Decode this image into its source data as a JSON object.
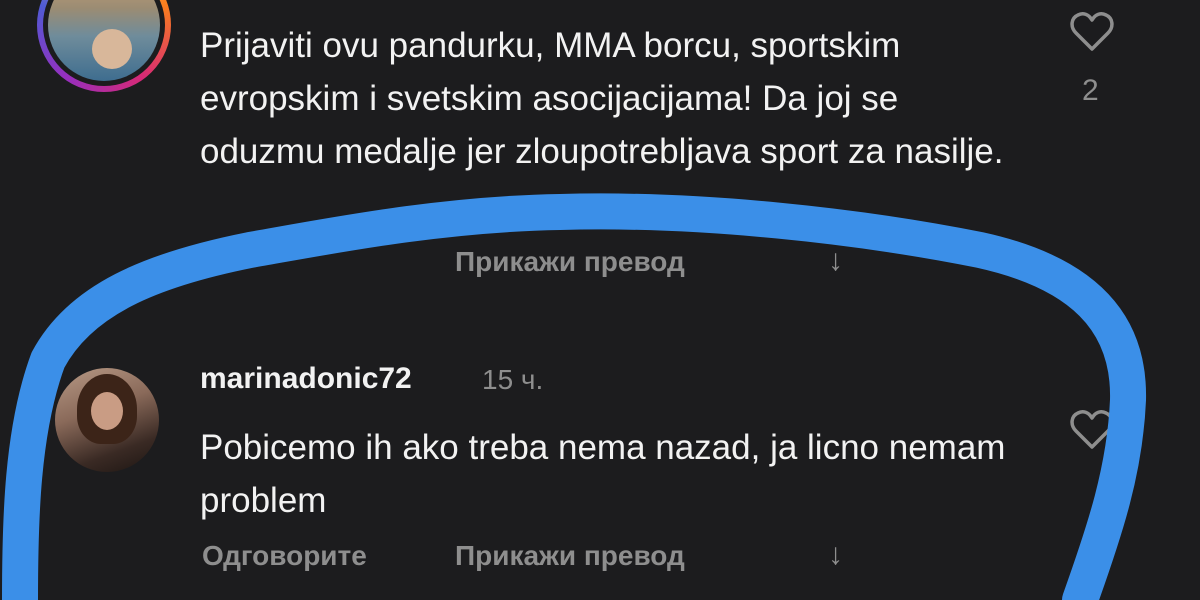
{
  "comment_1": {
    "text": "Prijaviti ovu pandurku, MMA borcu, sportskim evropskim i svetskim asocijacijama! Da joj se oduzmu medalje jer zloupotrebljava sport za nasilje.",
    "like_count": "2",
    "translate_label": "Прикажи превод",
    "translate_icon": "arrow-down-icon",
    "like_icon": "heart-icon"
  },
  "comment_2": {
    "username": "marinadonic72",
    "timestamp": "15 ч.",
    "text": "Pobicemo ih ako treba nema nazad, ja licno nemam problem",
    "reply_label": "Одговорите",
    "translate_label": "Прикажи превод",
    "translate_icon": "arrow-down-icon",
    "like_icon": "heart-icon"
  },
  "colors": {
    "background": "#1c1c1e",
    "text": "#f2f2f2",
    "secondary_text": "#8e8e8e",
    "highlight_scribble": "#3b8fe8",
    "story_ring": [
      "#feda75",
      "#fa7e1e",
      "#d62976",
      "#962fbf",
      "#4f5bd5"
    ]
  }
}
